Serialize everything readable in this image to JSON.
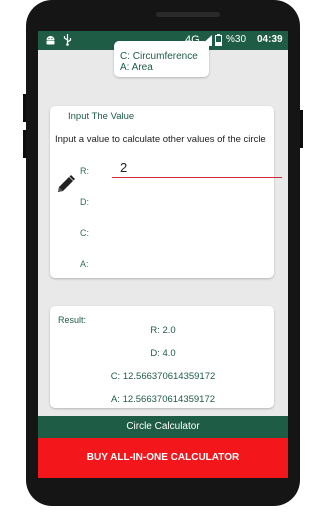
{
  "status_bar": {
    "network": "4G",
    "battery": "%30",
    "time": "04:39",
    "colors": {
      "bar": "#1e5c46"
    }
  },
  "legend": {
    "line1": "C: Circumference",
    "line2": "A: Area"
  },
  "input_section": {
    "title": "Input The Value",
    "instruction": "Input a value to calculate other values of the circle",
    "fields": [
      {
        "label": "R:",
        "value": "2"
      },
      {
        "label": "D:",
        "value": ""
      },
      {
        "label": "C:",
        "value": ""
      },
      {
        "label": "A:",
        "value": ""
      }
    ],
    "active_underline_color": "#cf2a35",
    "edit_icon": "pencil-icon"
  },
  "results": {
    "title": "Result:",
    "r": "R: 2.0",
    "d": "D: 4.0",
    "c": "C: 12.566370614359172",
    "a": "A: 12.566370614359172"
  },
  "footer": {
    "circle_button": "Circle Calculator",
    "buy_button": "BUY ALL-IN-ONE CALCULATOR",
    "colors": {
      "circle": "#1e5c46",
      "buy": "#f3161b"
    }
  }
}
